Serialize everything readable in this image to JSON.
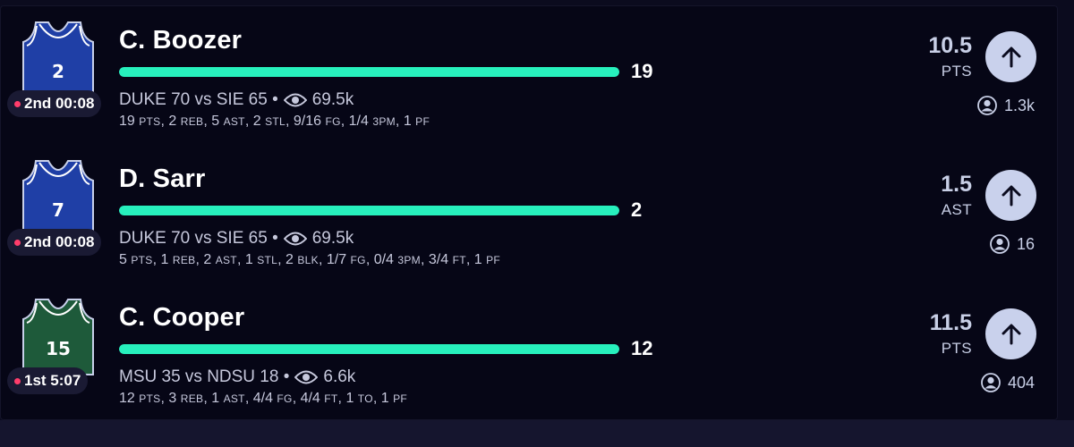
{
  "colors": {
    "background": "#060616",
    "progress": "#27f0bd",
    "track": "#22224a",
    "live_dot": "#ff3d6b",
    "button": "#c9d1ec"
  },
  "rows": [
    {
      "jersey": {
        "number": "2",
        "color": "#1f3fa6",
        "trim": "#ffffff"
      },
      "clock": "2nd 00:08",
      "player": "C. Boozer",
      "current_value": "19",
      "progress_fraction": 1.0,
      "game": "DUKE 70 vs SIE 65 •",
      "views": "69.5k",
      "box": [
        {
          "n": "19",
          "u": "PTS"
        },
        {
          "n": "2",
          "u": "REB"
        },
        {
          "n": "5",
          "u": "AST"
        },
        {
          "n": "2",
          "u": "STL"
        },
        {
          "n": "9/16",
          "u": "FG"
        },
        {
          "n": "1/4",
          "u": "3PM"
        },
        {
          "n": "1",
          "u": "PF"
        }
      ],
      "line": "10.5",
      "stat": "PTS",
      "picks": "1.3k"
    },
    {
      "jersey": {
        "number": "7",
        "color": "#1f3fa6",
        "trim": "#ffffff"
      },
      "clock": "2nd 00:08",
      "player": "D. Sarr",
      "current_value": "2",
      "progress_fraction": 1.0,
      "game": "DUKE 70 vs SIE 65 •",
      "views": "69.5k",
      "box": [
        {
          "n": "5",
          "u": "PTS"
        },
        {
          "n": "1",
          "u": "REB"
        },
        {
          "n": "2",
          "u": "AST"
        },
        {
          "n": "1",
          "u": "STL"
        },
        {
          "n": "2",
          "u": "BLK"
        },
        {
          "n": "1/7",
          "u": "FG"
        },
        {
          "n": "0/4",
          "u": "3PM"
        },
        {
          "n": "3/4",
          "u": "FT"
        },
        {
          "n": "1",
          "u": "PF"
        }
      ],
      "line": "1.5",
      "stat": "AST",
      "picks": "16"
    },
    {
      "jersey": {
        "number": "15",
        "color": "#1e5a3a",
        "trim": "#ffffff"
      },
      "clock": "1st 5:07",
      "player": "C. Cooper",
      "current_value": "12",
      "progress_fraction": 1.0,
      "game": "MSU 35 vs NDSU 18 •",
      "views": "6.6k",
      "box": [
        {
          "n": "12",
          "u": "PTS"
        },
        {
          "n": "3",
          "u": "REB"
        },
        {
          "n": "1",
          "u": "AST"
        },
        {
          "n": "4/4",
          "u": "FG"
        },
        {
          "n": "4/4",
          "u": "FT"
        },
        {
          "n": "1",
          "u": "TO"
        },
        {
          "n": "1",
          "u": "PF"
        }
      ],
      "line": "11.5",
      "stat": "PTS",
      "picks": "404"
    }
  ],
  "icons": {
    "watchers": "eye-icon",
    "picks": "user-icon",
    "action": "arrow-up-icon"
  }
}
